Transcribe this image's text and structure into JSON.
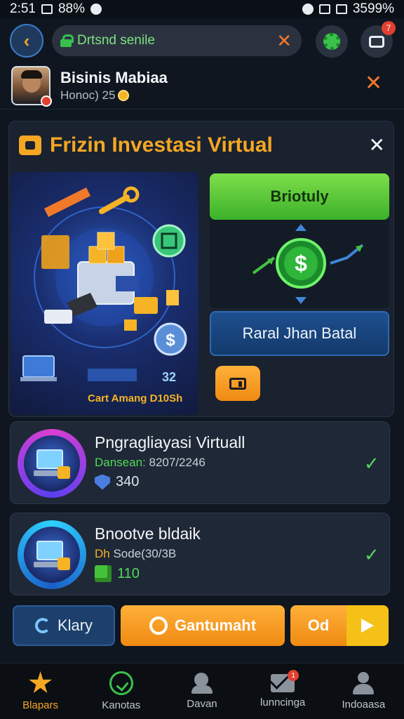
{
  "status_bar": {
    "time": "2:51",
    "battery_small": "88%",
    "battery": "3599%"
  },
  "top_bar": {
    "url_text": "Drtsnd senile",
    "camera_badge": "7"
  },
  "profile": {
    "name": "Bisinis Mabiaa",
    "subtitle": "Honoc) 25"
  },
  "panel": {
    "title": "Frizin Investasi Virtual",
    "hero_stat": "32",
    "hero_caption": "Cart Amang D10Sh",
    "green_button": "Briotuly",
    "blue_button": "Raral Jhan Batal"
  },
  "items": [
    {
      "title": "Pngragliayasi Virtuall",
      "sub_label": "Dansean:",
      "sub_value": "8207/2246",
      "value": "340"
    },
    {
      "title": "Bnootve bldaik",
      "sub_label": "Dh",
      "sub_value": "Sode(30/3B",
      "value": "110"
    }
  ],
  "actions": {
    "left": "Klary",
    "main": "Gantumaht",
    "right": "Od"
  },
  "nav": [
    {
      "label": "Blapars",
      "active": true
    },
    {
      "label": "Kanotas"
    },
    {
      "label": "Davan"
    },
    {
      "label": "lunncinga",
      "badge": "1"
    },
    {
      "label": "Indoaasa"
    }
  ],
  "colors": {
    "accent": "#f5a623",
    "green": "#3cc24a",
    "blue": "#1e4f8f",
    "bg": "#0f1620"
  }
}
